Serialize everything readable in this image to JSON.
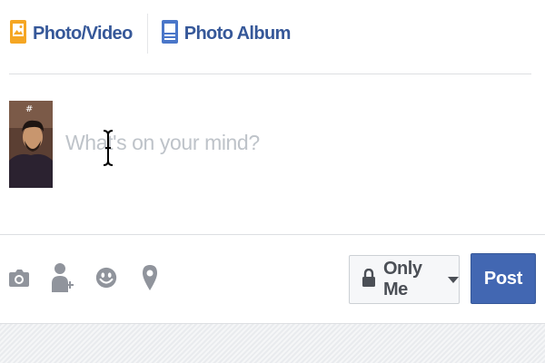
{
  "tabs": {
    "photo_video": {
      "label": "Photo/Video",
      "icon": "photo-video-icon",
      "icon_color": "#f5a623"
    },
    "photo_album": {
      "label": "Photo Album",
      "icon": "photo-album-icon",
      "icon_color": "#4a76c9"
    }
  },
  "composer": {
    "placeholder": "What's on your mind?",
    "avatar": "user-avatar"
  },
  "actions": [
    {
      "name": "camera-icon"
    },
    {
      "name": "tag-friends-icon"
    },
    {
      "name": "feeling-emoji-icon"
    },
    {
      "name": "location-pin-icon"
    }
  ],
  "privacy": {
    "label": "Only Me",
    "icon": "lock-icon"
  },
  "post_button": {
    "label": "Post",
    "color": "#4267b2"
  },
  "colors": {
    "link_blue": "#365899",
    "placeholder_gray": "#bec3c9",
    "icon_gray": "#90949c"
  }
}
